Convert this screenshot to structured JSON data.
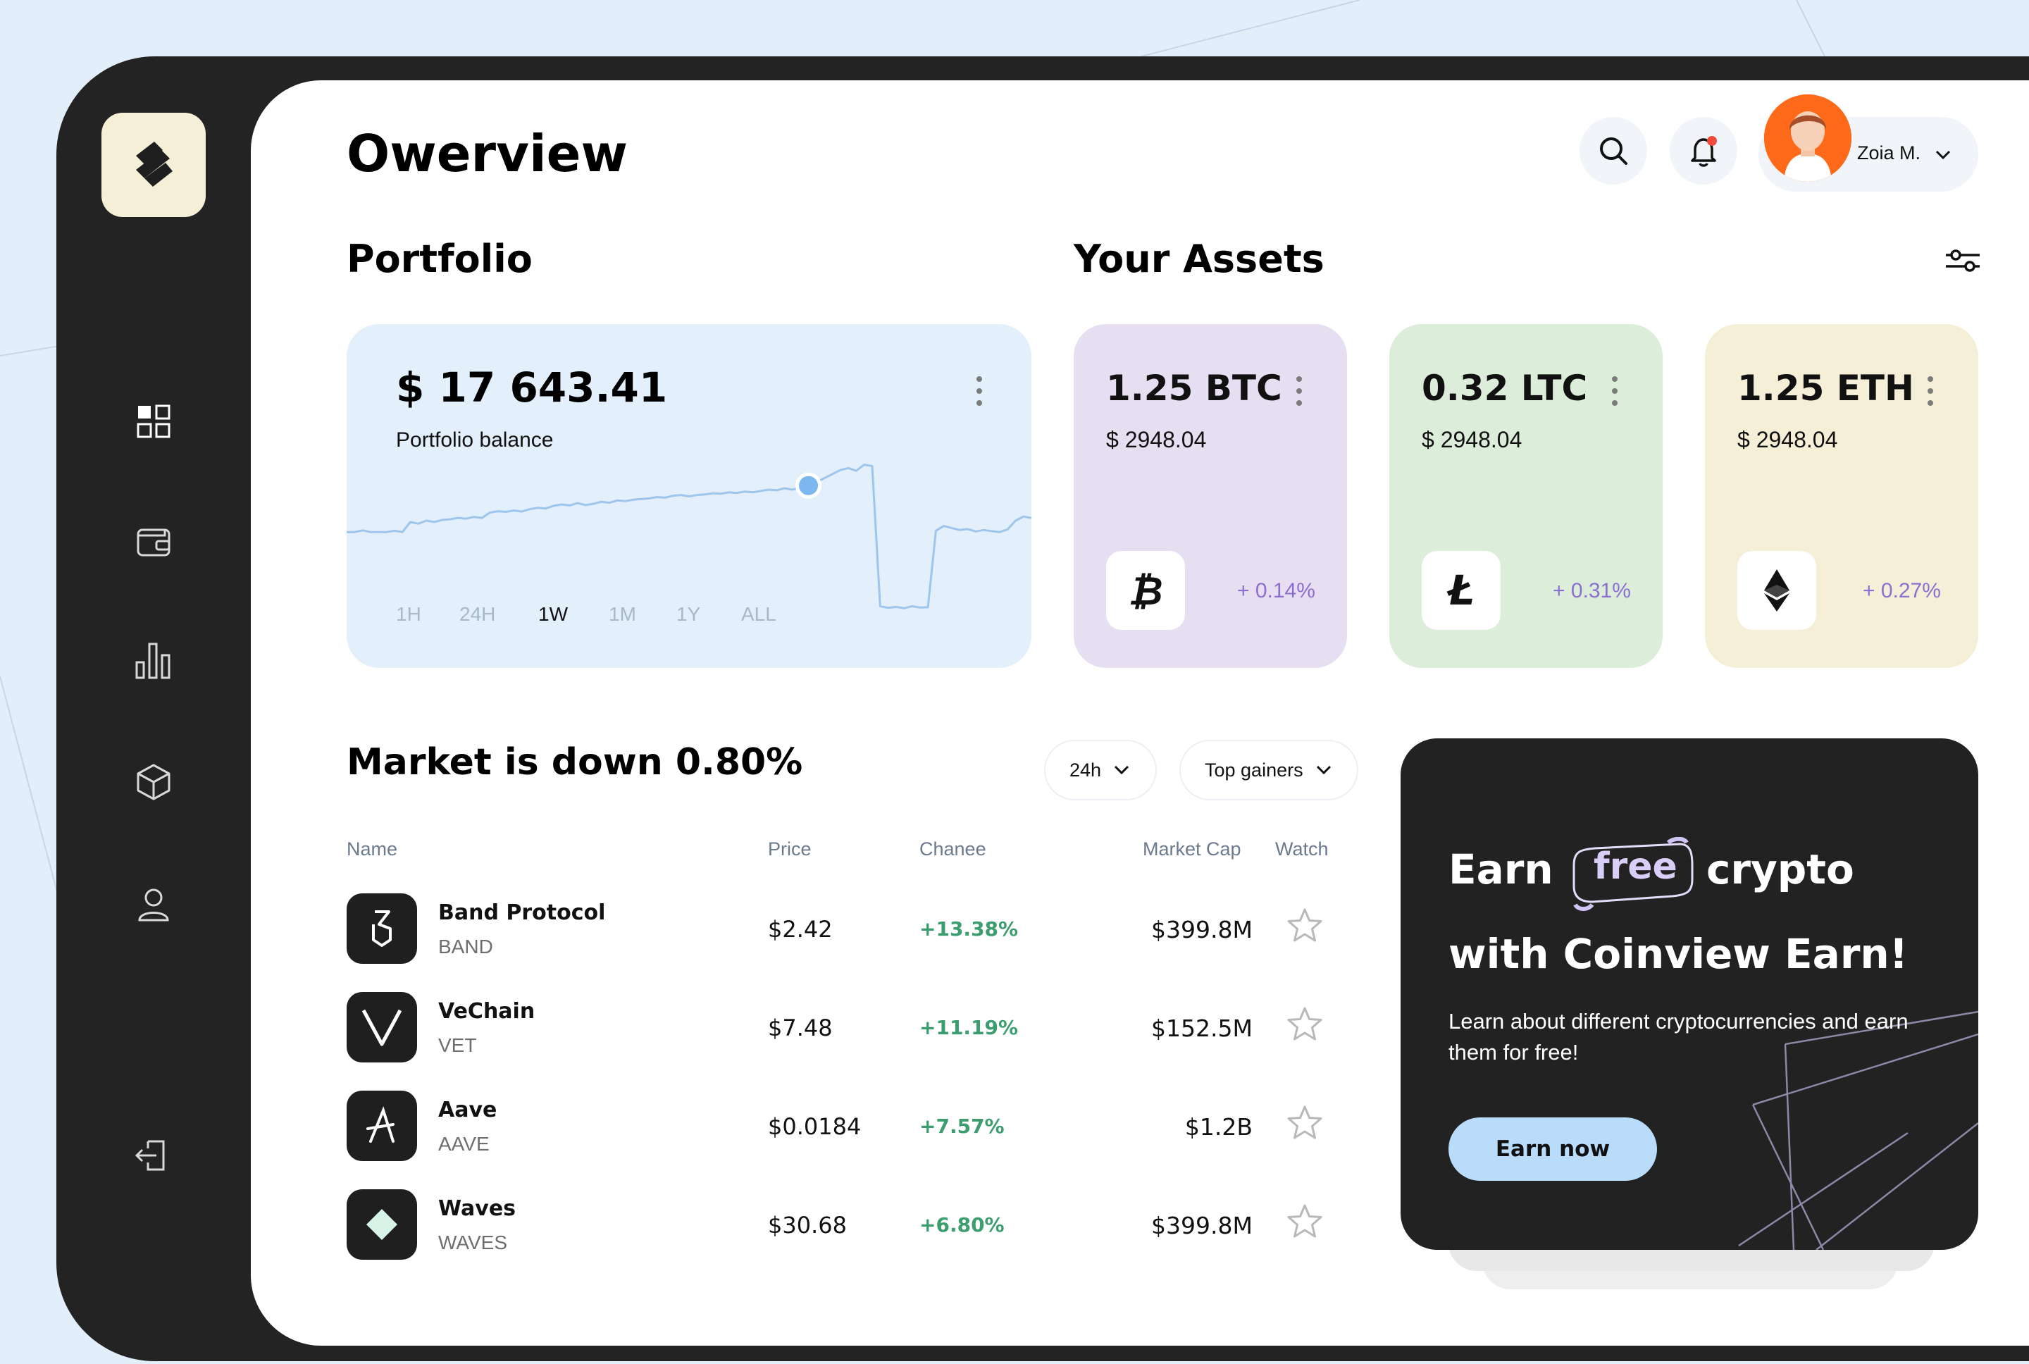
{
  "colors": {
    "background": "#e3eefb",
    "device": "#232323",
    "portfolio_card": "#e3effb",
    "btc_card": "#e6def1",
    "ltc_card": "#dcedda",
    "eth_card": "#f6efd8",
    "positive": "#3c9e6e",
    "asset_change": "#8c6fd0",
    "earn_button": "#b9dcfb"
  },
  "sidebar": {
    "logo": "brand-logo",
    "items": [
      {
        "icon": "dashboard-icon"
      },
      {
        "icon": "wallet-icon"
      },
      {
        "icon": "bar-chart-icon"
      },
      {
        "icon": "cube-icon"
      },
      {
        "icon": "user-icon"
      }
    ],
    "logout_icon": "logout-icon"
  },
  "header": {
    "title": "Owerview",
    "search_icon": "search-icon",
    "notification_icon": "bell-icon",
    "user_name": "Zoia M."
  },
  "portfolio": {
    "heading": "Portfolio",
    "balance": "$ 17 643.41",
    "balance_label": "Portfolio balance",
    "timeframes": [
      "1H",
      "24H",
      "1W",
      "1M",
      "1Y",
      "ALL"
    ],
    "active_timeframe": "1W"
  },
  "chart_data": {
    "type": "line",
    "title": "",
    "xlabel": "",
    "ylabel": "",
    "series": [
      {
        "values": [
          10,
          10,
          10.5,
          10,
          10,
          10,
          10.4,
          10,
          13,
          12.5,
          13.4,
          13,
          13.6,
          13.8,
          14.2,
          14,
          14.5,
          14.2,
          15.8,
          16.2,
          16,
          16.4,
          16.1,
          16.8,
          17.2,
          17,
          17.8,
          18.2,
          17.9,
          18.6,
          18,
          18.4,
          19,
          18.7,
          19.4,
          19.2,
          19.6,
          19.8,
          20,
          20.4,
          20.2,
          20.8,
          21,
          20.6,
          21,
          21.2,
          21.5,
          21.4,
          21.8,
          21.6,
          22,
          21.8,
          22.2,
          22.6,
          22.4,
          23,
          22.6,
          23.2,
          23.8,
          24.8,
          26,
          27.2,
          28.4,
          29,
          28.2,
          30,
          29.6,
          -12,
          -12.5,
          -12.2,
          -12.6,
          -12,
          -12.4,
          -12.3,
          10.4,
          11.8,
          11.2,
          10.6,
          10.9,
          10.2,
          10.6,
          10.3,
          10,
          10.8,
          13.4,
          14.6,
          14.2
        ],
        "highlight_index": 58
      }
    ]
  },
  "assets": {
    "heading": "Your Assets",
    "filter_icon": "sliders-icon",
    "items": [
      {
        "amount": "1.25 BTC",
        "usd": "$ 2948.04",
        "change": "+ 0.14%",
        "icon": "bitcoin-icon"
      },
      {
        "amount": "0.32 LTC",
        "usd": "$ 2948.04",
        "change": "+ 0.31%",
        "icon": "litecoin-icon"
      },
      {
        "amount": "1.25 ETH",
        "usd": "$ 2948.04",
        "change": "+ 0.27%",
        "icon": "ethereum-icon"
      }
    ]
  },
  "market": {
    "heading": "Market is down 0.80%",
    "period_select": "24h",
    "sort_select": "Top gainers",
    "columns": [
      "Name",
      "Price",
      "Chanee",
      "Market Cap",
      "Watch"
    ],
    "rows": [
      {
        "name": "Band Protocol",
        "symbol": "BAND",
        "price": "$2.42",
        "change": "+13.38%",
        "cap": "$399.8M",
        "icon": "band-protocol-icon"
      },
      {
        "name": "VeChain",
        "symbol": "VET",
        "price": "$7.48",
        "change": "+11.19%",
        "cap": "$152.5M",
        "icon": "vechain-icon"
      },
      {
        "name": "Aave",
        "symbol": "AAVE",
        "price": "$0.0184",
        "change": "+7.57%",
        "cap": "$1.2B",
        "icon": "aave-icon"
      },
      {
        "name": "Waves",
        "symbol": "WAVES",
        "price": "$30.68",
        "change": "+6.80%",
        "cap": "$399.8M",
        "icon": "waves-icon"
      }
    ]
  },
  "promo": {
    "line1_a": "Earn",
    "line1_badge": "free",
    "line1_b": "crypto",
    "line2": "with Coinview Earn!",
    "description": "Learn about different cryptocurrencies and earn them for free!",
    "button": "Earn now"
  }
}
